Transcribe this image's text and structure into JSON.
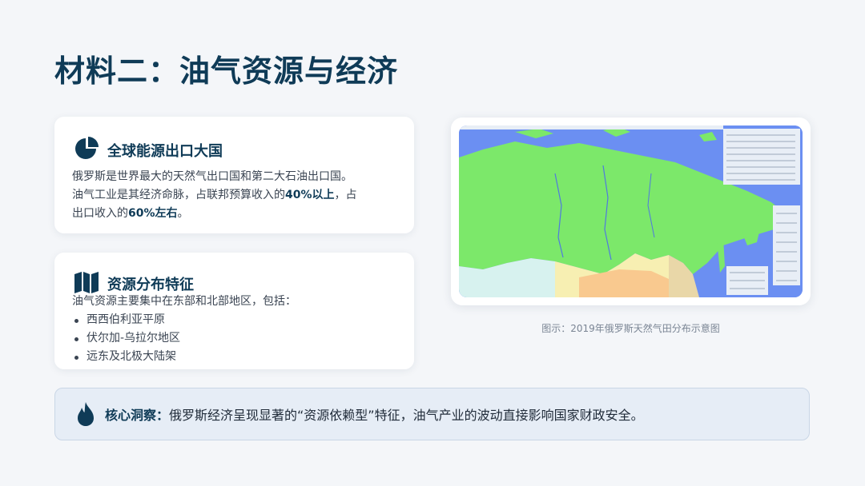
{
  "title": "材料二：油气资源与经济",
  "card1": {
    "icon": "pie-chart-icon",
    "title": "全球能源出口大国",
    "line1": "俄罗斯是世界最大的天然气出口国和第二大石油出口国。",
    "line2_a": "油气工业是其经济命脉，占联邦预算收入的",
    "line2_b": "40%以上",
    "line2_c": "，占",
    "line3_a": "出口收入的",
    "line3_b": "60%左右",
    "line3_c": "。"
  },
  "card2": {
    "icon": "map-icon",
    "title": "资源分布特征",
    "intro": "油气资源主要集中在东部和北部地区，包括：",
    "items": [
      "西西伯利亚平原",
      "伏尔加-乌拉尔地区",
      "远东及北极大陆架"
    ]
  },
  "map": {
    "caption": "图示：2019年俄罗斯天然气田分布示意图"
  },
  "insight": {
    "icon": "flame-icon",
    "label": "核心洞察：",
    "text": "俄罗斯经济呈现显著的“资源依赖型”特征，油气产业的波动直接影响国家财政安全。"
  }
}
